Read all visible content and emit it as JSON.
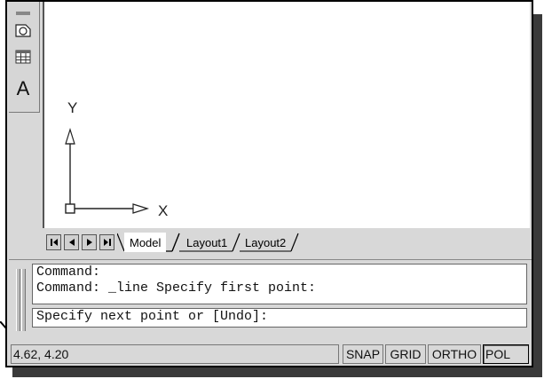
{
  "toolbar": {
    "items": [
      {
        "icon": "region-icon"
      },
      {
        "icon": "table-icon"
      },
      {
        "icon": "multiline-text-icon",
        "label": "A"
      }
    ]
  },
  "ucs": {
    "y_label": "Y",
    "x_label": "X"
  },
  "layout_tabs": {
    "tabs": [
      "Model",
      "Layout1",
      "Layout2"
    ],
    "active": "Model"
  },
  "command": {
    "history": [
      "Command:",
      "Command: _line Specify first point:"
    ],
    "current": "Specify next point or [Undo]:"
  },
  "status": {
    "coordinates": "4.62, 4.20",
    "buttons": [
      "SNAP",
      "GRID",
      "ORTHO",
      "POL"
    ]
  }
}
